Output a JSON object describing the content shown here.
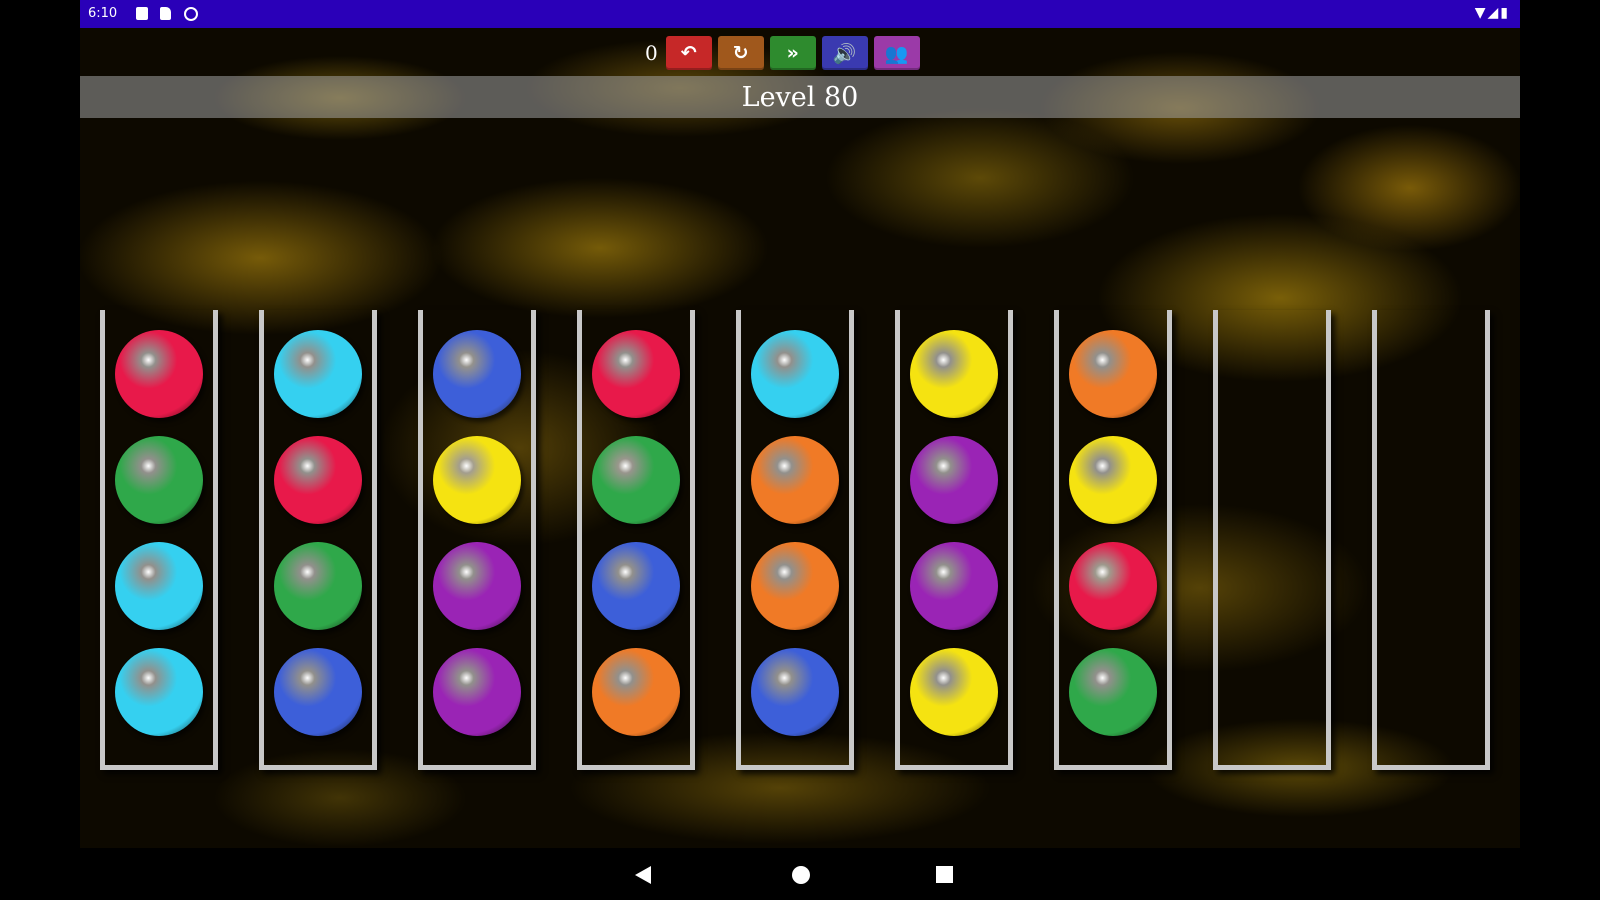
{
  "status_bar": {
    "time": "6:10",
    "left_icons": [
      "notification-square-icon",
      "sd-card-icon",
      "sync-icon"
    ],
    "right_icons": [
      "wifi-icon",
      "signal-icon",
      "battery-icon"
    ],
    "background": "#2a00b8"
  },
  "toolbar": {
    "move_count": "0",
    "buttons": [
      {
        "name": "undo-button",
        "icon": "undo-icon",
        "glyph": "↶",
        "color": "#c62828"
      },
      {
        "name": "restart-button",
        "icon": "restart-icon",
        "glyph": "↻",
        "color": "#a0581c"
      },
      {
        "name": "skip-button",
        "icon": "fast-forward-icon",
        "glyph": "»",
        "color": "#2e8b2e"
      },
      {
        "name": "sound-button",
        "icon": "speaker-icon",
        "glyph": "🔊",
        "color": "#3a3ab0"
      },
      {
        "name": "players-button",
        "icon": "users-icon",
        "glyph": "👥",
        "color": "#9b3aa8"
      }
    ]
  },
  "level": {
    "label": "Level 80"
  },
  "colors": {
    "red": "#e8194a",
    "cyan": "#35d0f0",
    "green": "#2fa84a",
    "blue": "#3d5fd9",
    "yellow": "#f5e311",
    "purple": "#9a24b5",
    "orange": "#f07a26"
  },
  "tubes": [
    {
      "balls_top_to_bottom": [
        "red",
        "green",
        "cyan",
        "cyan"
      ]
    },
    {
      "balls_top_to_bottom": [
        "cyan",
        "red",
        "green",
        "blue"
      ]
    },
    {
      "balls_top_to_bottom": [
        "blue",
        "yellow",
        "purple",
        "purple"
      ]
    },
    {
      "balls_top_to_bottom": [
        "red",
        "green",
        "blue",
        "orange"
      ]
    },
    {
      "balls_top_to_bottom": [
        "cyan",
        "orange",
        "orange",
        "blue"
      ]
    },
    {
      "balls_top_to_bottom": [
        "yellow",
        "purple",
        "purple",
        "yellow"
      ]
    },
    {
      "balls_top_to_bottom": [
        "orange",
        "yellow",
        "red",
        "green"
      ]
    },
    {
      "balls_top_to_bottom": []
    },
    {
      "balls_top_to_bottom": []
    }
  ],
  "nav_bar": {
    "icons": [
      "back-icon",
      "home-icon",
      "recents-icon"
    ]
  }
}
